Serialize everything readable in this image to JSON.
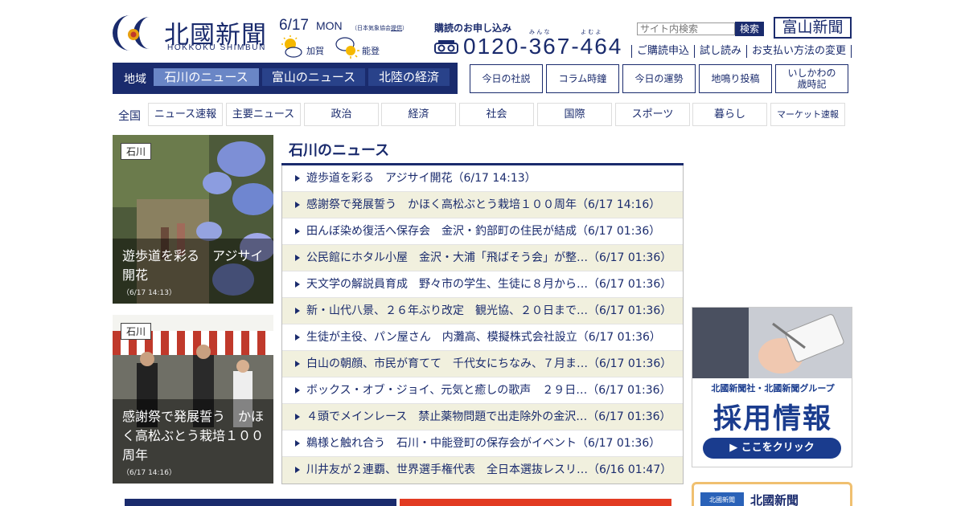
{
  "header": {
    "logo_name": "北國新聞",
    "logo_sub": "HOKKOKU SHIMBUN",
    "date": "6/17",
    "weekday": "MON",
    "weather_credit_prefix": "（日本気象協会",
    "weather_credit_link": "提供",
    "weather_credit_suffix": "）",
    "weather": [
      {
        "area": "加賀",
        "icon": "sun-cloud-icon"
      },
      {
        "area": "能登",
        "icon": "cloud-sun-icon"
      }
    ],
    "subscribe_title": "購読のお申し込み",
    "ruby_1": "み ん な",
    "ruby_2": "よ む よ",
    "phone": "0120-367-464",
    "search_placeholder": "サイト内検索",
    "search_button": "検索",
    "toyama_link": "富山新聞",
    "util_links": [
      "ご購読申込",
      "試し読み",
      "お支払い方法の変更"
    ]
  },
  "region_nav": {
    "label": "地域",
    "tabs": [
      {
        "label": "石川のニュース",
        "active": true
      },
      {
        "label": "富山のニュース",
        "active": false
      },
      {
        "label": "北陸の経済",
        "active": false
      }
    ]
  },
  "column_links": [
    "今日の社説",
    "コラム時鐘",
    "今日の運勢",
    "地鳴り投稿",
    "いしかわの\n歳時記"
  ],
  "categories": {
    "all": "全国",
    "items": [
      "ニュース速報",
      "主要ニュース",
      "政治",
      "経済",
      "社会",
      "国際",
      "スポーツ",
      "暮らし",
      "マーケット速報"
    ]
  },
  "photos": [
    {
      "tag": "石川",
      "title": "遊歩道を彩る　アジサイ開花",
      "time": "（6/17 14:13）"
    },
    {
      "tag": "石川",
      "title": "感謝祭で発展誓う　かほく高松ぶとう栽培１００周年",
      "time": "（6/17 14:16）"
    }
  ],
  "news": {
    "title": "石川のニュース",
    "items": [
      "遊歩道を彩る　アジサイ開花（6/17 14:13）",
      "感謝祭で発展誓う　かほく高松ぶとう栽培１００周年（6/17 14:16）",
      "田んぼ染め復活へ保存会　金沢・釣部町の住民が結成（6/17 01:36）",
      "公民館にホタル小屋　金沢・大浦「飛ばそう会」が整…（6/17 01:36）",
      "天文学の解説員育成　野々市の学生、生徒に８月から…（6/17 01:36）",
      "新・山代八景、２６年ぶり改定　観光協、２０日まで…（6/17 01:36）",
      "生徒が主役、パン屋さん　内灘高、模擬株式会社設立（6/17 01:36）",
      "白山の朝顔、市民が育てて　千代女にちなみ、７月ま…（6/17 01:36）",
      "ボックス・オブ・ジョイ、元気と癒しの歌声　２９日…（6/17 01:36）",
      "４頭でメインレース　禁止薬物問題で出走除外の金沢…（6/17 01:36）",
      "鵜様と触れ合う　石川・中能登町の保存会がイベント（6/17 01:36）",
      "川井友が２連覇、世界選手権代表　全日本選抜レスリ…（6/16 01:47）"
    ]
  },
  "ad": {
    "sub": "北國新聞社・北國新聞グループ",
    "main": "採用情報",
    "button": "▶ ここをクリック"
  },
  "promo": {
    "block_text": "北國新聞",
    "name": "北國新聞"
  },
  "colors": {
    "navy": "#1a2b6d",
    "active_tab": "#6a86c6",
    "stripe": "#f1f0de",
    "ad_blue": "#1a3c8e"
  }
}
